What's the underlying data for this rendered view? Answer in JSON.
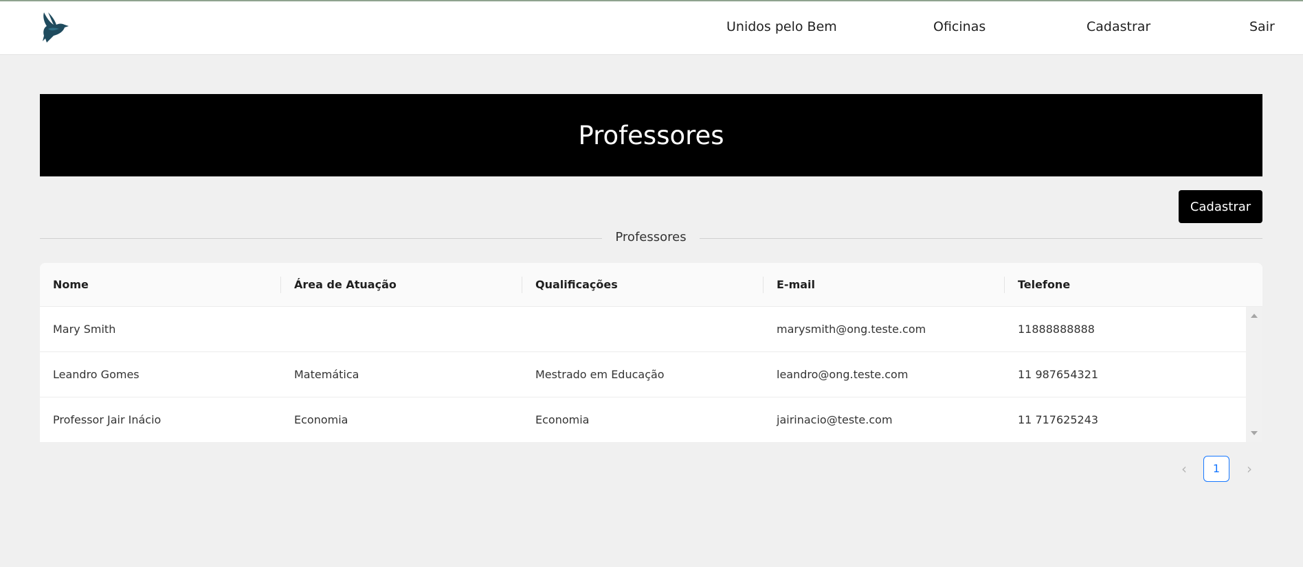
{
  "header": {
    "logo_icon": "dove-bird-icon",
    "nav": [
      "Unidos pelo Bem",
      "Oficinas",
      "Cadastrar",
      "Sair"
    ]
  },
  "banner": {
    "title": "Professores"
  },
  "actions": {
    "create_label": "Cadastrar"
  },
  "section": {
    "label": "Professores"
  },
  "table": {
    "columns": [
      "Nome",
      "Área de Atuação",
      "Qualificações",
      "E-mail",
      "Telefone"
    ],
    "rows": [
      [
        "Mary Smith",
        "",
        "",
        "marysmith@ong.teste.com",
        "11888888888"
      ],
      [
        "Leandro Gomes",
        "Matemática",
        "Mestrado em Educação",
        "leandro@ong.teste.com",
        "11 987654321"
      ],
      [
        "Professor Jair Inácio",
        "Economia",
        "Economia",
        "jairinacio@teste.com",
        "11 717625243"
      ]
    ]
  },
  "pagination": {
    "prev_icon": "chevron-left-icon",
    "next_icon": "chevron-right-icon",
    "current_page": "1"
  },
  "colors": {
    "accent": "#1677ff",
    "banner_bg": "#000000",
    "page_bg": "#f0f0f0"
  }
}
